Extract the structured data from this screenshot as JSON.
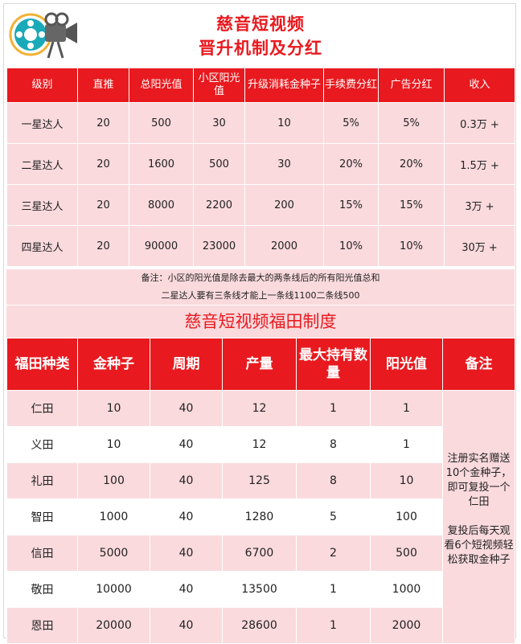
{
  "header": {
    "title_line1": "慈音短视频",
    "title_line2": "晋升机制及分红"
  },
  "table1": {
    "headers": [
      "级别",
      "直推",
      "总阳光值",
      "小区阳光值",
      "升级消耗金种子",
      "手续费分红",
      "广告分红",
      "收入"
    ],
    "rows": [
      [
        "一星达人",
        "20",
        "500",
        "30",
        "10",
        "5%",
        "5%",
        "0.3万 +"
      ],
      [
        "二星达人",
        "20",
        "1600",
        "500",
        "30",
        "20%",
        "20%",
        "1.5万 +"
      ],
      [
        "三星达人",
        "20",
        "8000",
        "2200",
        "200",
        "15%",
        "15%",
        "3万 +"
      ],
      [
        "四星达人",
        "20",
        "90000",
        "23000",
        "2000",
        "10%",
        "10%",
        "30万 +"
      ]
    ]
  },
  "note": {
    "line1": "备注：小区的阳光值是除去最大的两条线后的所有阳光值总和",
    "line2": "二星达人要有三条线才能上一条线1100二条线500"
  },
  "section2_title": "慈音短视频福田制度",
  "table2": {
    "headers": [
      "福田种类",
      "金种子",
      "周期",
      "产量",
      "最大持有数量",
      "阳光值",
      "备注"
    ],
    "rows": [
      [
        "仁田",
        "10",
        "40",
        "12",
        "1",
        "1"
      ],
      [
        "义田",
        "10",
        "40",
        "12",
        "8",
        "1"
      ],
      [
        "礼田",
        "100",
        "40",
        "125",
        "8",
        "10"
      ],
      [
        "智田",
        "1000",
        "40",
        "1280",
        "5",
        "100"
      ],
      [
        "信田",
        "5000",
        "40",
        "6700",
        "2",
        "500"
      ],
      [
        "敬田",
        "10000",
        "40",
        "13500",
        "1",
        "1000"
      ],
      [
        "恩田",
        "20000",
        "40",
        "28600",
        "1",
        "2000"
      ]
    ],
    "remark1": "注册实名赠送10个金种子，即可复投一个仁田",
    "remark2": "复投后每天观看6个短视频轻松获取金种子"
  },
  "logo": {
    "icon": "film-camera-icon",
    "colors": [
      "#1aa9b8",
      "#f2b134",
      "#555555"
    ]
  }
}
